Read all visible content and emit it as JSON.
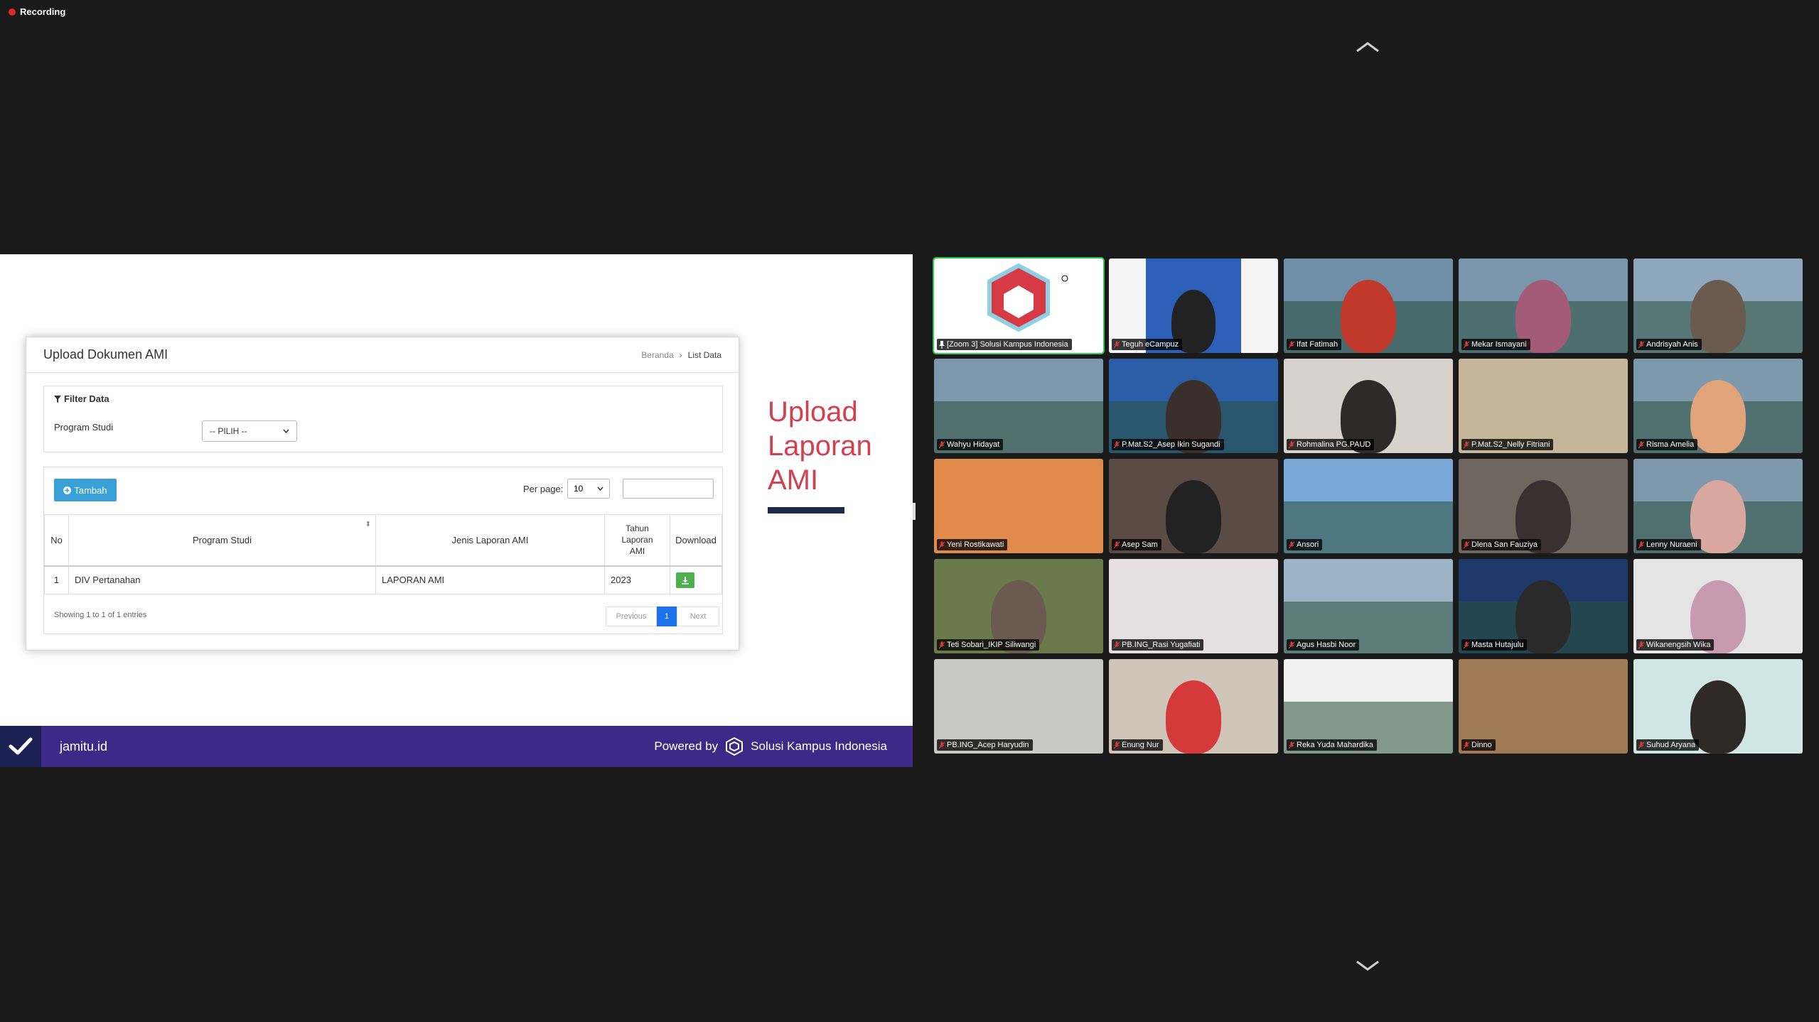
{
  "recording": {
    "label": "Recording"
  },
  "slide": {
    "panel_title": "Upload Dokumen AMI",
    "breadcrumb": {
      "home": "Beranda",
      "current": "List Data"
    },
    "filter": {
      "title": "Filter Data",
      "program_studi_label": "Program Studi",
      "program_studi_value": "-- PILIH --"
    },
    "toolbar": {
      "add_label": "Tambah",
      "per_page_label": "Per page:",
      "per_page_value": "10",
      "search_value": ""
    },
    "table": {
      "headers": {
        "no": "No",
        "program_studi": "Program Studi",
        "jenis": "Jenis Laporan AMI",
        "tahun_l1": "Tahun",
        "tahun_l2": "Laporan",
        "tahun_l3": "AMI",
        "download": "Download"
      },
      "rows": [
        {
          "no": "1",
          "program_studi": "DIV Pertanahan",
          "jenis": "LAPORAN AMI",
          "tahun": "2023"
        }
      ]
    },
    "showing": "Showing 1 to 1 of 1 entries",
    "pager": {
      "previous": "Previous",
      "page": "1",
      "next": "Next"
    },
    "heading": {
      "line1": "Upload",
      "line2": "Laporan",
      "line3": "AMI"
    },
    "footer": {
      "site": "jamitu.id",
      "powered_by": "Powered by",
      "brand": "Solusi Kampus Indonesia"
    }
  },
  "participants": [
    {
      "name": "[Zoom 3] Solusi Kampus Indonesia",
      "bg": "#ffffff",
      "kind": "logo",
      "active": true
    },
    {
      "name": "Teguh eCampuz",
      "bg": "#f4f4f4",
      "kind": "poster"
    },
    {
      "name": "Ifat Fatimah",
      "bg": "#6f8fa8",
      "kind": "building",
      "face": "#c0392b"
    },
    {
      "name": "Mekar Ismayani",
      "bg": "#7a96ad",
      "kind": "building",
      "face": "#a35b78"
    },
    {
      "name": "Andrisyah Anis",
      "bg": "#8fa7bd",
      "kind": "building",
      "face": "#6b5b4f"
    },
    {
      "name": "Wahyu Hidayat",
      "bg": "#7e98ac",
      "kind": "building",
      "face": ""
    },
    {
      "name": "P.Mat.S2_Asep Ikin Sugandi",
      "bg": "#2c5ea8",
      "kind": "building",
      "face": "#3a2f2a"
    },
    {
      "name": "Rohmalina PG.PAUD",
      "bg": "#d8d2cc",
      "kind": "room",
      "face": "#2e2a2a"
    },
    {
      "name": "P.Mat.S2_Nelly Fitriani",
      "bg": "#c7b79a",
      "kind": "flowers",
      "face": ""
    },
    {
      "name": "Risma Amelia",
      "bg": "#7e98ac",
      "kind": "building",
      "face": "#e0a37a"
    },
    {
      "name": "Yeni Rostikawati",
      "bg": "#e08a4c",
      "kind": "sunset",
      "face": ""
    },
    {
      "name": "Asep Sam",
      "bg": "#5a4c44",
      "kind": "street",
      "face": "#222"
    },
    {
      "name": "Ansori",
      "bg": "#7aa7d6",
      "kind": "building",
      "face": ""
    },
    {
      "name": "Dlena San Fauziya",
      "bg": "#6f6660",
      "kind": "room",
      "face": "#3b3030"
    },
    {
      "name": "Lenny Nuraeni",
      "bg": "#7e98ac",
      "kind": "building",
      "face": "#d8a8a0"
    },
    {
      "name": "Teti Sobari_IKIP Siliwangi",
      "bg": "#6b7a4a",
      "kind": "sunset",
      "face": "#6a5a50"
    },
    {
      "name": "PB.ING_Rasi Yugafiati",
      "bg": "#e6dfe2",
      "kind": "blur",
      "face": ""
    },
    {
      "name": "Agus Hasbi Noor",
      "bg": "#9cb4c6",
      "kind": "building",
      "face": ""
    },
    {
      "name": "Masta Hutajulu",
      "bg": "#1f3a6a",
      "kind": "seminar",
      "face": "#2a2a2a"
    },
    {
      "name": "Wikanengsih Wika",
      "bg": "#e4e4e4",
      "kind": "room",
      "face": "#c79ab0"
    },
    {
      "name": "PB.ING_Acep Haryudin",
      "bg": "#c8c8c4",
      "kind": "room",
      "face": ""
    },
    {
      "name": "Enung Nur",
      "bg": "#cfc5b8",
      "kind": "room",
      "face": "#d43a3a"
    },
    {
      "name": "Reka Yuda Mahardika",
      "bg": "#f0f0f0",
      "kind": "banner",
      "face": ""
    },
    {
      "name": "Dinno",
      "bg": "#a07a55",
      "kind": "wood",
      "face": ""
    },
    {
      "name": "Suhud Aryana",
      "bg": "#cfe6e3",
      "kind": "room",
      "face": "#2f2a28"
    }
  ],
  "colors": {
    "active_border": "#2fc84c",
    "footer": "#3d2a88",
    "heading": "#d34050"
  }
}
